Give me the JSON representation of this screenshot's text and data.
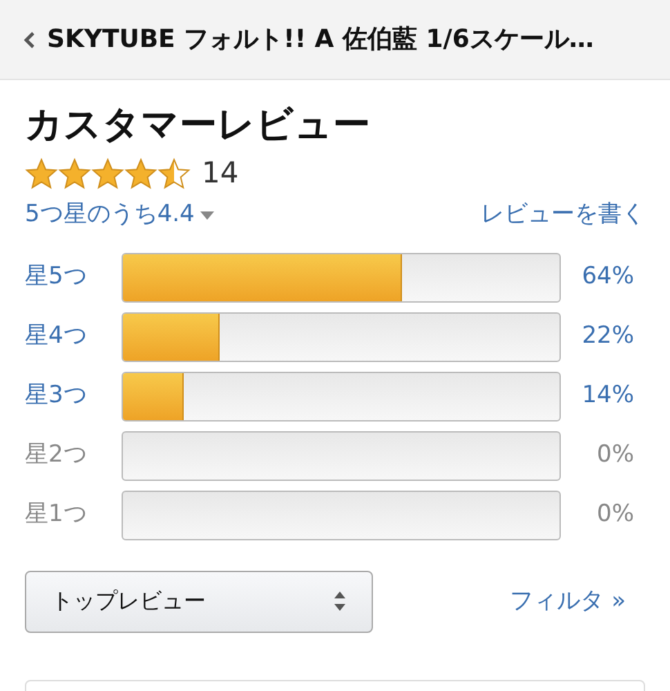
{
  "header": {
    "title": "SKYTUBE フォルト!! A 佐伯藍 1/6スケール…"
  },
  "reviews": {
    "heading": "カスタマーレビュー",
    "stars": 4.5,
    "count": "14",
    "average": "5つ星のうち4.4",
    "write_link": "レビューを書く"
  },
  "histogram": [
    {
      "label": "星5つ",
      "level": 0.64,
      "percent": "64%",
      "disabled": false
    },
    {
      "label": "星4つ",
      "level": 0.22,
      "percent": "22%",
      "disabled": false
    },
    {
      "label": "星3つ",
      "level": 0.14,
      "percent": "14%",
      "disabled": false
    },
    {
      "label": "星2つ",
      "level": 0,
      "percent": "0%",
      "disabled": true
    },
    {
      "label": "星1つ",
      "level": 0,
      "percent": "0%",
      "disabled": true
    }
  ],
  "sort": {
    "value": "トップレビュー"
  },
  "filter_link": "フィルタ »"
}
